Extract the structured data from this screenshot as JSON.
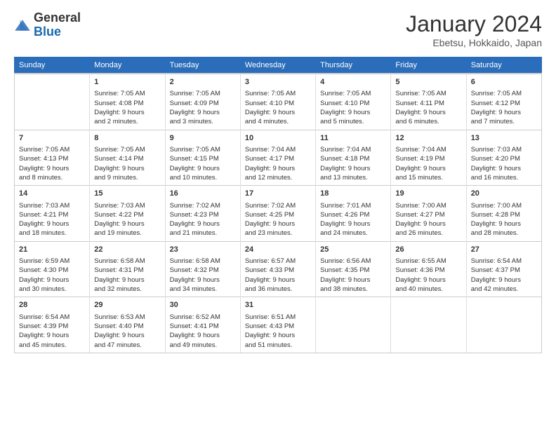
{
  "header": {
    "logo_general": "General",
    "logo_blue": "Blue",
    "month_year": "January 2024",
    "location": "Ebetsu, Hokkaido, Japan"
  },
  "days_of_week": [
    "Sunday",
    "Monday",
    "Tuesday",
    "Wednesday",
    "Thursday",
    "Friday",
    "Saturday"
  ],
  "weeks": [
    [
      {
        "day": "",
        "info": ""
      },
      {
        "day": "1",
        "info": "Sunrise: 7:05 AM\nSunset: 4:08 PM\nDaylight: 9 hours\nand 2 minutes."
      },
      {
        "day": "2",
        "info": "Sunrise: 7:05 AM\nSunset: 4:09 PM\nDaylight: 9 hours\nand 3 minutes."
      },
      {
        "day": "3",
        "info": "Sunrise: 7:05 AM\nSunset: 4:10 PM\nDaylight: 9 hours\nand 4 minutes."
      },
      {
        "day": "4",
        "info": "Sunrise: 7:05 AM\nSunset: 4:10 PM\nDaylight: 9 hours\nand 5 minutes."
      },
      {
        "day": "5",
        "info": "Sunrise: 7:05 AM\nSunset: 4:11 PM\nDaylight: 9 hours\nand 6 minutes."
      },
      {
        "day": "6",
        "info": "Sunrise: 7:05 AM\nSunset: 4:12 PM\nDaylight: 9 hours\nand 7 minutes."
      }
    ],
    [
      {
        "day": "7",
        "info": "Sunrise: 7:05 AM\nSunset: 4:13 PM\nDaylight: 9 hours\nand 8 minutes."
      },
      {
        "day": "8",
        "info": "Sunrise: 7:05 AM\nSunset: 4:14 PM\nDaylight: 9 hours\nand 9 minutes."
      },
      {
        "day": "9",
        "info": "Sunrise: 7:05 AM\nSunset: 4:15 PM\nDaylight: 9 hours\nand 10 minutes."
      },
      {
        "day": "10",
        "info": "Sunrise: 7:04 AM\nSunset: 4:17 PM\nDaylight: 9 hours\nand 12 minutes."
      },
      {
        "day": "11",
        "info": "Sunrise: 7:04 AM\nSunset: 4:18 PM\nDaylight: 9 hours\nand 13 minutes."
      },
      {
        "day": "12",
        "info": "Sunrise: 7:04 AM\nSunset: 4:19 PM\nDaylight: 9 hours\nand 15 minutes."
      },
      {
        "day": "13",
        "info": "Sunrise: 7:03 AM\nSunset: 4:20 PM\nDaylight: 9 hours\nand 16 minutes."
      }
    ],
    [
      {
        "day": "14",
        "info": "Sunrise: 7:03 AM\nSunset: 4:21 PM\nDaylight: 9 hours\nand 18 minutes."
      },
      {
        "day": "15",
        "info": "Sunrise: 7:03 AM\nSunset: 4:22 PM\nDaylight: 9 hours\nand 19 minutes."
      },
      {
        "day": "16",
        "info": "Sunrise: 7:02 AM\nSunset: 4:23 PM\nDaylight: 9 hours\nand 21 minutes."
      },
      {
        "day": "17",
        "info": "Sunrise: 7:02 AM\nSunset: 4:25 PM\nDaylight: 9 hours\nand 23 minutes."
      },
      {
        "day": "18",
        "info": "Sunrise: 7:01 AM\nSunset: 4:26 PM\nDaylight: 9 hours\nand 24 minutes."
      },
      {
        "day": "19",
        "info": "Sunrise: 7:00 AM\nSunset: 4:27 PM\nDaylight: 9 hours\nand 26 minutes."
      },
      {
        "day": "20",
        "info": "Sunrise: 7:00 AM\nSunset: 4:28 PM\nDaylight: 9 hours\nand 28 minutes."
      }
    ],
    [
      {
        "day": "21",
        "info": "Sunrise: 6:59 AM\nSunset: 4:30 PM\nDaylight: 9 hours\nand 30 minutes."
      },
      {
        "day": "22",
        "info": "Sunrise: 6:58 AM\nSunset: 4:31 PM\nDaylight: 9 hours\nand 32 minutes."
      },
      {
        "day": "23",
        "info": "Sunrise: 6:58 AM\nSunset: 4:32 PM\nDaylight: 9 hours\nand 34 minutes."
      },
      {
        "day": "24",
        "info": "Sunrise: 6:57 AM\nSunset: 4:33 PM\nDaylight: 9 hours\nand 36 minutes."
      },
      {
        "day": "25",
        "info": "Sunrise: 6:56 AM\nSunset: 4:35 PM\nDaylight: 9 hours\nand 38 minutes."
      },
      {
        "day": "26",
        "info": "Sunrise: 6:55 AM\nSunset: 4:36 PM\nDaylight: 9 hours\nand 40 minutes."
      },
      {
        "day": "27",
        "info": "Sunrise: 6:54 AM\nSunset: 4:37 PM\nDaylight: 9 hours\nand 42 minutes."
      }
    ],
    [
      {
        "day": "28",
        "info": "Sunrise: 6:54 AM\nSunset: 4:39 PM\nDaylight: 9 hours\nand 45 minutes."
      },
      {
        "day": "29",
        "info": "Sunrise: 6:53 AM\nSunset: 4:40 PM\nDaylight: 9 hours\nand 47 minutes."
      },
      {
        "day": "30",
        "info": "Sunrise: 6:52 AM\nSunset: 4:41 PM\nDaylight: 9 hours\nand 49 minutes."
      },
      {
        "day": "31",
        "info": "Sunrise: 6:51 AM\nSunset: 4:43 PM\nDaylight: 9 hours\nand 51 minutes."
      },
      {
        "day": "",
        "info": ""
      },
      {
        "day": "",
        "info": ""
      },
      {
        "day": "",
        "info": ""
      }
    ]
  ]
}
